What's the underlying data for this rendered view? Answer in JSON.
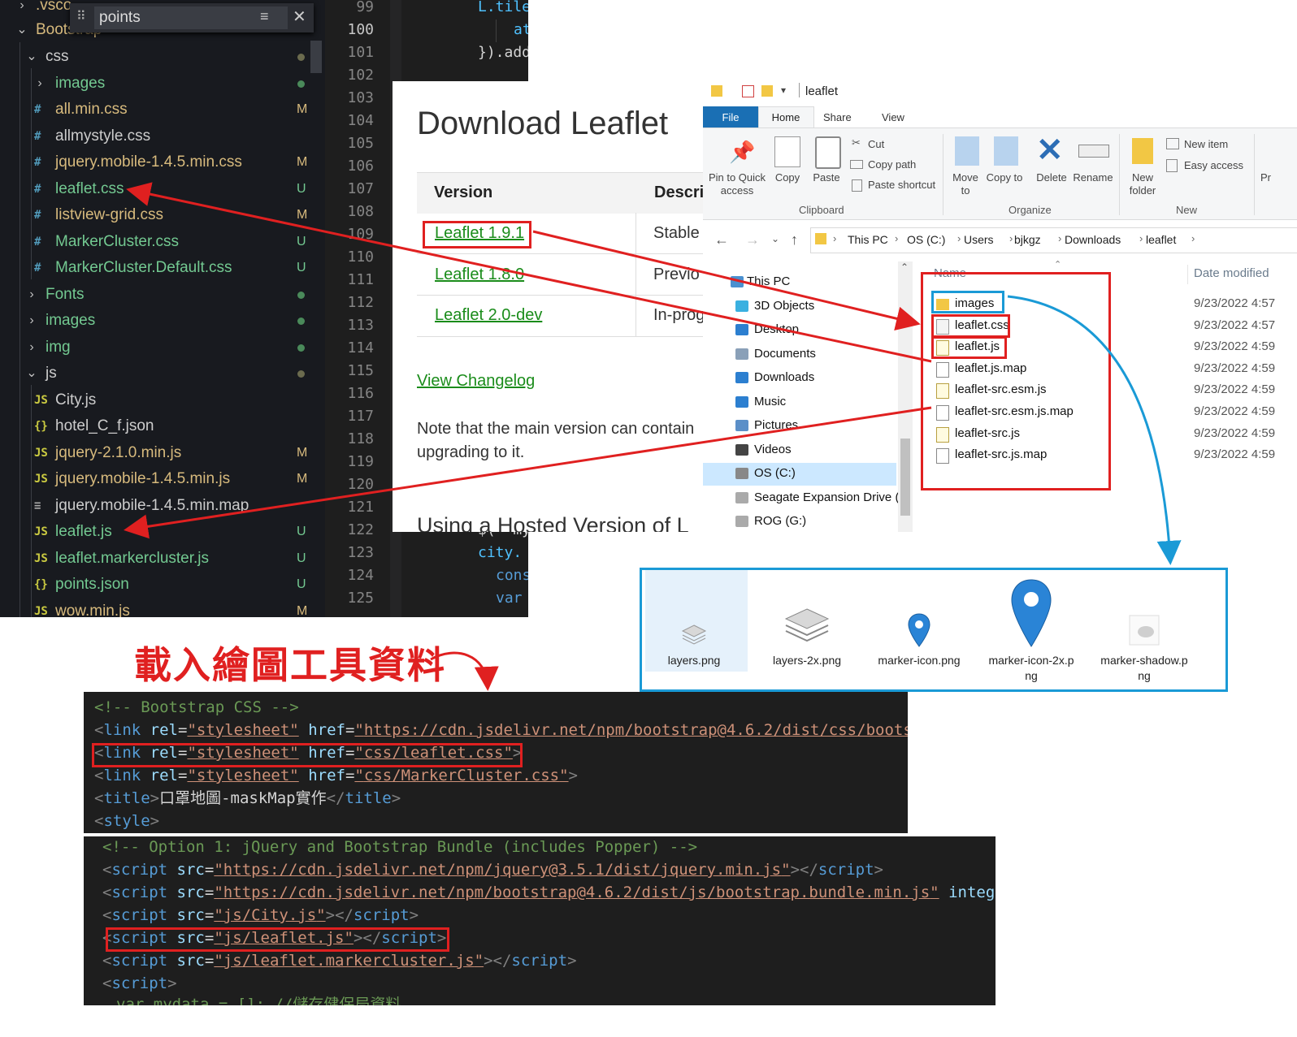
{
  "vscode": {
    "top_folder": ".vsco",
    "root_folder": "Bootstrap",
    "search_text": "points",
    "tree": [
      {
        "indent": 1,
        "type": "folder",
        "open": true,
        "name": "css",
        "color": "plain",
        "status": "dot"
      },
      {
        "indent": 2,
        "type": "folder",
        "open": false,
        "name": "images",
        "color": "green",
        "status": "dot-green"
      },
      {
        "indent": 2,
        "type": "css",
        "name": "all.min.css",
        "color": "yellow",
        "status": "M"
      },
      {
        "indent": 2,
        "type": "css",
        "name": "allmystyle.css",
        "color": "plain",
        "status": ""
      },
      {
        "indent": 2,
        "type": "css",
        "name": "jquery.mobile-1.4.5.min.css",
        "color": "yellow",
        "status": "M"
      },
      {
        "indent": 2,
        "type": "css",
        "name": "leaflet.css",
        "color": "green",
        "status": "U"
      },
      {
        "indent": 2,
        "type": "css",
        "name": "listview-grid.css",
        "color": "yellow",
        "status": "M"
      },
      {
        "indent": 2,
        "type": "css",
        "name": "MarkerCluster.css",
        "color": "green",
        "status": "U"
      },
      {
        "indent": 2,
        "type": "css",
        "name": "MarkerCluster.Default.css",
        "color": "green",
        "status": "U"
      },
      {
        "indent": 1,
        "type": "folder",
        "open": false,
        "name": "Fonts",
        "color": "green",
        "status": "dot-green"
      },
      {
        "indent": 1,
        "type": "folder",
        "open": false,
        "name": "images",
        "color": "green",
        "status": "dot-green"
      },
      {
        "indent": 1,
        "type": "folder",
        "open": false,
        "name": "img",
        "color": "green",
        "status": "dot-green"
      },
      {
        "indent": 1,
        "type": "folder",
        "open": true,
        "name": "js",
        "color": "plain",
        "status": "dot"
      },
      {
        "indent": 2,
        "type": "js",
        "name": "City.js",
        "color": "plain",
        "status": ""
      },
      {
        "indent": 2,
        "type": "json",
        "name": "hotel_C_f.json",
        "color": "plain",
        "status": ""
      },
      {
        "indent": 2,
        "type": "js",
        "name": "jquery-2.1.0.min.js",
        "color": "yellow",
        "status": "M"
      },
      {
        "indent": 2,
        "type": "js",
        "name": "jquery.mobile-1.4.5.min.js",
        "color": "yellow",
        "status": "M"
      },
      {
        "indent": 2,
        "type": "map",
        "name": "jquery.mobile-1.4.5.min.map",
        "color": "plain",
        "status": ""
      },
      {
        "indent": 2,
        "type": "js",
        "name": "leaflet.js",
        "color": "green",
        "status": "U"
      },
      {
        "indent": 2,
        "type": "js",
        "name": "leaflet.markercluster.js",
        "color": "green",
        "status": "U"
      },
      {
        "indent": 2,
        "type": "json",
        "name": "points.json",
        "color": "green",
        "status": "U"
      },
      {
        "indent": 2,
        "type": "js",
        "name": "wow.min.js",
        "color": "yellow",
        "status": "M"
      }
    ]
  },
  "gutter": {
    "lines": [
      "99",
      "100",
      "101",
      "102",
      "103",
      "104",
      "105",
      "106",
      "107",
      "108",
      "109",
      "110",
      "111",
      "112",
      "113",
      "114",
      "115",
      "116",
      "117",
      "118",
      "119",
      "120",
      "121",
      "122",
      "123",
      "124",
      "125"
    ],
    "code_snippets": [
      "L.tile",
      "at",
      "}).add",
      "$( 'my",
      "city.",
      "cons",
      "var"
    ]
  },
  "download_page": {
    "title": "Download Leaflet",
    "col_version": "Version",
    "col_desc": "Descri",
    "rows": [
      {
        "version": "Leaflet 1.9.1",
        "desc": "Stable"
      },
      {
        "version": "Leaflet 1.8.0",
        "desc": "Previo"
      },
      {
        "version": "Leaflet 2.0-dev",
        "desc": "In-prog"
      }
    ],
    "changelog": "View Changelog",
    "note_line1": "Note that the main version can contain",
    "note_line2": "upgrading to it.",
    "hosted_heading": "Using a Hosted Version of L"
  },
  "file_explorer": {
    "title": "leaflet",
    "tabs": [
      "File",
      "Home",
      "Share",
      "View"
    ],
    "ribbon": {
      "pin": "Pin to Quick access",
      "copy": "Copy",
      "paste": "Paste",
      "cut": "Cut",
      "copy_path": "Copy path",
      "paste_shortcut": "Paste shortcut",
      "move_to": "Move to",
      "copy_to": "Copy to",
      "delete": "Delete",
      "rename": "Rename",
      "new_folder": "New folder",
      "new_item": "New item",
      "easy_access": "Easy access",
      "pr": "Pr",
      "group_clipboard": "Clipboard",
      "group_organize": "Organize",
      "group_new": "New"
    },
    "breadcrumb": [
      "This PC",
      "OS (C:)",
      "Users",
      "bjkgz",
      "Downloads",
      "leaflet"
    ],
    "nav": [
      "This PC",
      "3D Objects",
      "Desktop",
      "Documents",
      "Downloads",
      "Music",
      "Pictures",
      "Videos",
      "OS (C:)",
      "Seagate Expansion Drive (I",
      "ROG (G:)"
    ],
    "col_name": "Name",
    "col_date": "Date modified",
    "files": [
      {
        "name": "images",
        "date": "9/23/2022 4:57",
        "kind": "folder"
      },
      {
        "name": "leaflet.css",
        "date": "9/23/2022 4:57",
        "kind": "css"
      },
      {
        "name": "leaflet.js",
        "date": "9/23/2022 4:59",
        "kind": "js"
      },
      {
        "name": "leaflet.js.map",
        "date": "9/23/2022 4:59",
        "kind": "file"
      },
      {
        "name": "leaflet-src.esm.js",
        "date": "9/23/2022 4:59",
        "kind": "js"
      },
      {
        "name": "leaflet-src.esm.js.map",
        "date": "9/23/2022 4:59",
        "kind": "file"
      },
      {
        "name": "leaflet-src.js",
        "date": "9/23/2022 4:59",
        "kind": "js"
      },
      {
        "name": "leaflet-src.js.map",
        "date": "9/23/2022 4:59",
        "kind": "file"
      }
    ]
  },
  "images_panel": {
    "items": [
      {
        "line1": "layers.png",
        "line2": ""
      },
      {
        "line1": "layers-2x.png",
        "line2": ""
      },
      {
        "line1": "marker-icon.png",
        "line2": ""
      },
      {
        "line1": "marker-icon-2x.p",
        "line2": "ng"
      },
      {
        "line1": "marker-shadow.p",
        "line2": "ng"
      }
    ]
  },
  "annotation": "載入繪圖工具資料",
  "code1": {
    "comment": "<!-- Bootstrap CSS -->",
    "link1_href": "https://cdn.jsdelivr.net/npm/bootstrap@4.6.2/dist/css/boots",
    "link2_href": "css/leaflet.css",
    "link3_href": "css/MarkerCluster.css",
    "title_text": "口罩地圖-maskMap實作",
    "tag_link": "link",
    "attr_rel": "rel",
    "val_stylesheet": "\"stylesheet\"",
    "attr_href": "href",
    "tag_title": "title",
    "tag_style": "style"
  },
  "code2": {
    "comment": "<!-- Option 1: jQuery and Bootstrap Bundle (includes Popper) -->",
    "src1": "https://cdn.jsdelivr.net/npm/jquery@3.5.1/dist/jquery.min.js",
    "src2": "https://cdn.jsdelivr.net/npm/bootstrap@4.6.2/dist/js/bootstrap.bundle.min.js",
    "integr": "integr",
    "src3": "js/City.js",
    "src4": "js/leaflet.js",
    "src5": "js/leaflet.markercluster.js",
    "tag_script": "script",
    "attr_src": "src",
    "cut_line": "var mydata = []; //儲存健保局資料"
  },
  "colors": {
    "annotation_red": "#e02020",
    "highlight_blue": "#1a9ad6",
    "link_green": "#1a8c1a"
  }
}
